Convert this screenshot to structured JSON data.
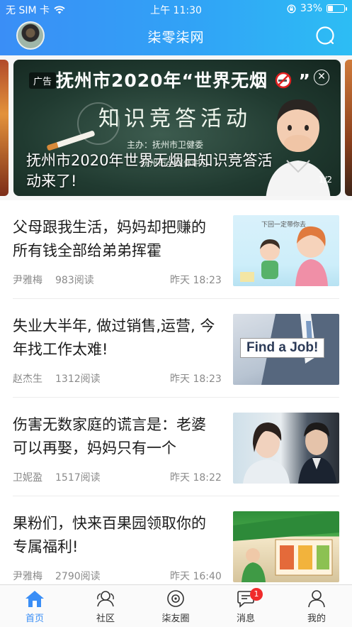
{
  "status_bar": {
    "carrier": "无 SIM 卡",
    "time": "上午 11:30",
    "battery_percent": "33%",
    "battery_level": 0.33,
    "icons": [
      "wifi-icon",
      "orientation-lock-icon",
      "battery-icon"
    ]
  },
  "header": {
    "title": "柒零柒网",
    "avatar_icon": "user-avatar",
    "search_icon": "search-icon"
  },
  "banner": {
    "ad_label": "广告",
    "headline": "抚州市2020年“世界无烟",
    "subheadline": "知识竞答活动",
    "organizer_line1": "主办：抚州市卫健委",
    "organizer_line2": "抚州市全媒体中心",
    "caption": "抚州市2020年世界无烟日知识竞答活动来了!",
    "pager": "1/2",
    "close_icon": "close-icon",
    "no_smoking_icon": "no-smoking-icon"
  },
  "articles": [
    {
      "title": "父母跟我生活，妈妈却把赚的所有钱全部给弟弟挥霍",
      "author": "尹雅梅",
      "reads": "983阅读",
      "time": "昨天 18:23",
      "thumb_caption": "下回一定带你去"
    },
    {
      "title": "失业大半年, 做过销售,运营, 今年找工作太难!",
      "author": "赵杰生",
      "reads": "1312阅读",
      "time": "昨天 18:23",
      "thumb_caption": "Find a Job!"
    },
    {
      "title": "伤害无数家庭的谎言是：老婆可以再娶，妈妈只有一个",
      "author": "卫妮盈",
      "reads": "1517阅读",
      "time": "昨天 18:22",
      "thumb_caption": ""
    },
    {
      "title": "果粉们，快来百果园领取你的专属福利!",
      "author": "尹雅梅",
      "reads": "2790阅读",
      "time": "昨天 16:40",
      "thumb_caption": ""
    }
  ],
  "tabbar": {
    "active_color": "#3a8ef6",
    "tabs": [
      {
        "label": "首页",
        "icon": "home-icon",
        "active": true
      },
      {
        "label": "社区",
        "icon": "community-icon",
        "active": false
      },
      {
        "label": "柒友圈",
        "icon": "moments-icon",
        "active": false
      },
      {
        "label": "消息",
        "icon": "message-icon",
        "active": false,
        "badge": "1"
      },
      {
        "label": "我的",
        "icon": "profile-icon",
        "active": false
      }
    ]
  }
}
